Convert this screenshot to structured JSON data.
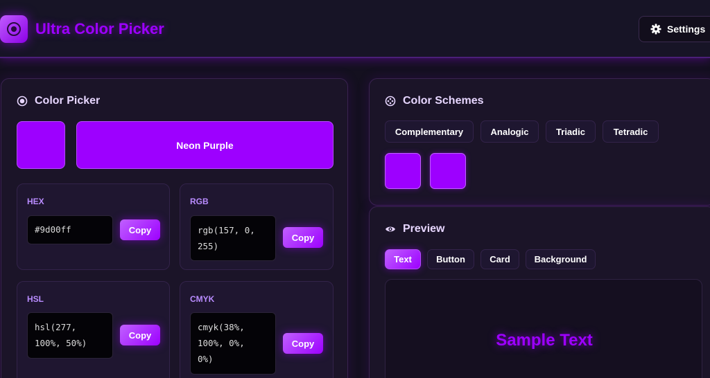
{
  "header": {
    "app_title": "Ultra Color Picker",
    "settings_label": "Settings",
    "logo_icon": "target-icon"
  },
  "colors": {
    "accent": "#9d00ff",
    "background": "#14101f",
    "panel": "#1b1428"
  },
  "color_picker": {
    "title": "Color Picker",
    "color_name": "Neon Purple",
    "current_color": "#9d00ff",
    "formats": [
      {
        "label": "HEX",
        "value": "#9d00ff",
        "copy_label": "Copy"
      },
      {
        "label": "RGB",
        "value": "rgb(157, 0,\n255)",
        "copy_label": "Copy"
      },
      {
        "label": "HSL",
        "value": "hsl(277,\n100%, 50%)",
        "copy_label": "Copy"
      },
      {
        "label": "CMYK",
        "value": "cmyk(38%,\n100%, 0%,\n0%)",
        "copy_label": "Copy"
      }
    ]
  },
  "color_schemes": {
    "title": "Color Schemes",
    "tabs": [
      "Complementary",
      "Analogic",
      "Triadic",
      "Tetradic"
    ],
    "swatches": [
      "#9d00ff",
      "#9d00ff"
    ]
  },
  "preview": {
    "title": "Preview",
    "tabs": [
      "Text",
      "Button",
      "Card",
      "Background"
    ],
    "active_tab": "Text",
    "sample_text": "Sample Text"
  }
}
